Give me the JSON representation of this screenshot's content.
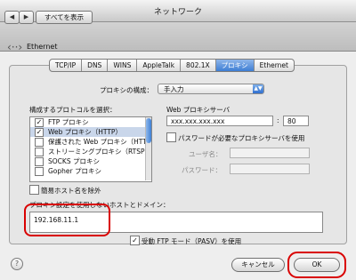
{
  "window": {
    "title": "ネットワーク"
  },
  "toolbar": {
    "back": "◀",
    "forward": "▶",
    "show_all": "すべてを表示"
  },
  "service": {
    "name": "Ethernet"
  },
  "tabs": [
    {
      "label": "TCP/IP"
    },
    {
      "label": "DNS"
    },
    {
      "label": "WINS"
    },
    {
      "label": "AppleTalk"
    },
    {
      "label": "802.1X"
    },
    {
      "label": "プロキシ"
    },
    {
      "label": "Ethernet"
    }
  ],
  "proxy_config": {
    "label": "プロキシの構成：",
    "value": "手入力"
  },
  "protocols": {
    "label": "構成するプロトコルを選択：",
    "items": [
      {
        "label": "FTP プロキシ",
        "checked": true
      },
      {
        "label": "Web プロキシ（HTTP）",
        "checked": true
      },
      {
        "label": "保護された Web プロキシ（HTTP",
        "checked": false
      },
      {
        "label": "ストリーミングプロキシ（RTSP）",
        "checked": false
      },
      {
        "label": "SOCKS プロキシ",
        "checked": false
      },
      {
        "label": "Gopher プロキシ",
        "checked": false
      }
    ]
  },
  "web_proxy": {
    "label": "Web プロキシサーバ",
    "server": "xxx.xxx.xxx.xxx",
    "port": "80",
    "auth_label": "パスワードが必要なプロキシサーバを使用",
    "username_label": "ユーザ名：",
    "password_label": "パスワード："
  },
  "simple_hostnames": {
    "label": "簡易ホスト名を除外",
    "checked": false
  },
  "bypass": {
    "label": "プロキシ設定を使用しないホストとドメイン：",
    "value": "192.168.11.1"
  },
  "pasv": {
    "label": "受動 FTP モード（PASV）を使用",
    "checked": true
  },
  "buttons": {
    "help": "?",
    "cancel": "キャンセル",
    "ok": "OK"
  },
  "glyphs": {
    "check": "✓",
    "updown": "▲▼",
    "network_icon": "‹··›"
  },
  "colors": {
    "accent": "#3d7ed4",
    "highlight": "#d90000"
  }
}
